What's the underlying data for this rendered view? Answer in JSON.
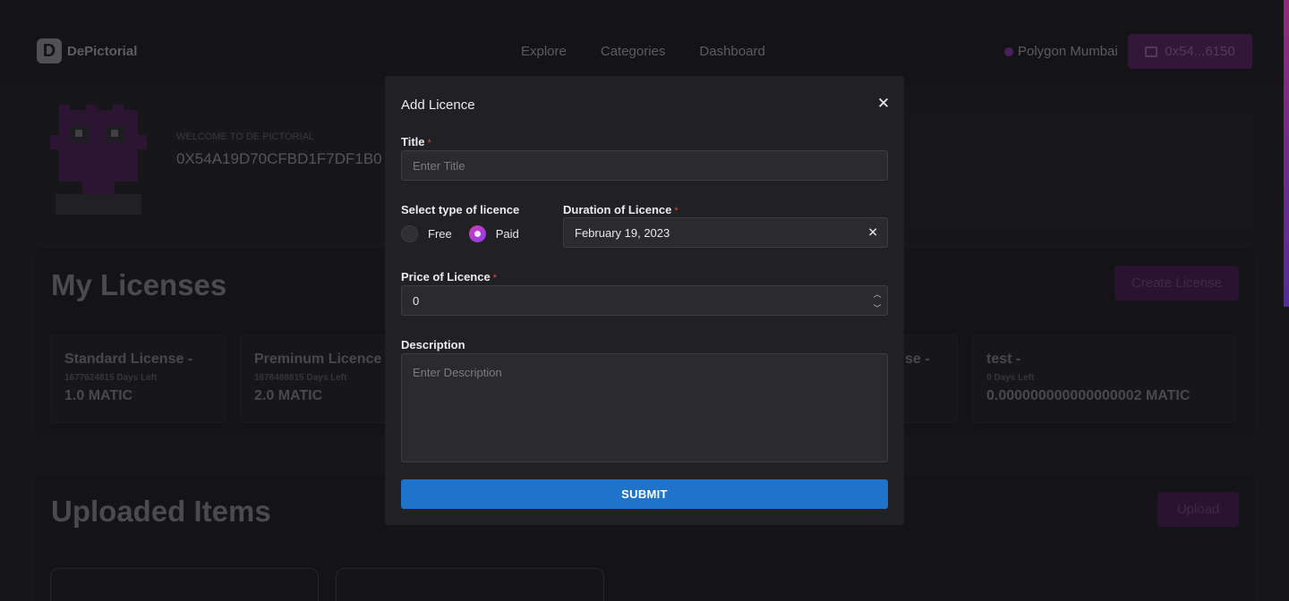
{
  "brand": {
    "name": "DePictorial",
    "mark": "D"
  },
  "nav": [
    "Explore",
    "Categories",
    "Dashboard"
  ],
  "network": "Polygon Mumbai",
  "wallet": "0x54...6150",
  "profile": {
    "welcome": "WELCOME TO DE PICTORIAL",
    "address": "0X54A19D70CFBD1F7DF1B0"
  },
  "licenses": {
    "title": "My Licenses",
    "create_label": "Create License",
    "cards": [
      {
        "name": "Standard License -",
        "days": "1677624815 Days Left",
        "price": "1.0 MATIC"
      },
      {
        "name": "Preminum Licence",
        "days": "1678488815 Days Left",
        "price": "2.0 MATIC"
      },
      {
        "name": "se -",
        "days": "",
        "price": ""
      },
      {
        "name": "test -",
        "days": "0 Days Left",
        "price": "0.000000000000000002 MATIC"
      }
    ]
  },
  "uploaded": {
    "title": "Uploaded Items",
    "upload_label": "Upload"
  },
  "modal": {
    "title": "Add Licence",
    "title_label": "Title",
    "title_placeholder": "Enter Title",
    "type_label": "Select type of licence",
    "type_options": [
      "Free",
      "Paid"
    ],
    "type_selected": "Paid",
    "duration_label": "Duration of Licence",
    "duration_value": "February 19, 2023",
    "price_label": "Price of Licence",
    "price_value": "0",
    "description_label": "Description",
    "description_placeholder": "Enter Description",
    "submit_label": "SUBMIT",
    "required_mark": "*"
  },
  "colors": {
    "accent": "#1f73c9",
    "brand_purple": "#4a1f52",
    "radio_gradient": [
      "#d13cb8",
      "#8a3ef0"
    ]
  }
}
